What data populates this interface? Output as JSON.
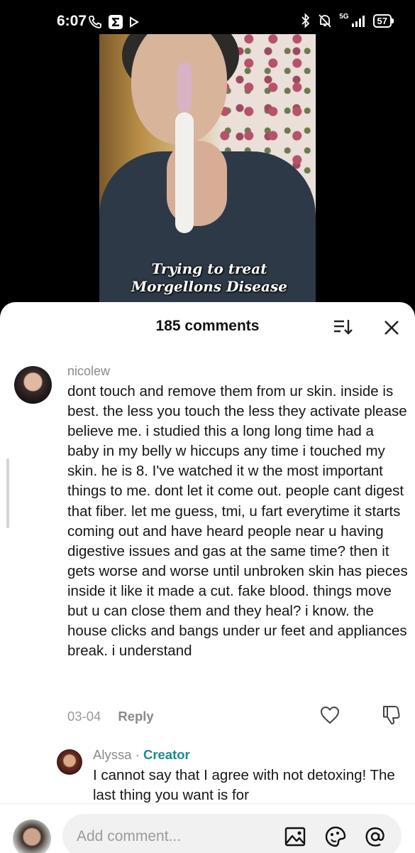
{
  "status_bar": {
    "time": "6:07",
    "network": "5G",
    "battery": "57"
  },
  "video": {
    "caption_line1": "Trying to treat",
    "caption_line2": "Morgellons Disease"
  },
  "comments_header": {
    "count_label": "185 comments"
  },
  "comment": {
    "author": "nicolew",
    "text": "dont touch and remove them from ur skin. inside is best. the less you touch the less they activate please believe me. i studied this a long long time had a baby in my belly w hiccups any time i touched my skin. he is 8. I've watched it w the most important things to me. dont let it come out. people cant digest that fiber. let me guess, tmi, u fart everytime it starts coming out and have heard people near u having digestive issues and gas at the same time? then it gets worse and worse until unbroken skin has pieces inside it like it made a cut. fake blood. things move but u can close them and they heal? i know. the house clicks and bangs under ur feet and appliances break. i understand",
    "date": "03-04",
    "reply_label": "Reply"
  },
  "reply": {
    "author": "Alyssa",
    "separator": "·",
    "badge": "Creator",
    "text": "I cannot say that I agree with not detoxing! The last thing you want is for"
  },
  "input": {
    "placeholder": "Add comment..."
  },
  "icons": {
    "sort": "sort-icon",
    "close": "close-icon",
    "like": "heart-outline-icon",
    "dislike": "thumbs-down-icon",
    "image": "image-icon",
    "emoji": "emoji-icon",
    "mention": "at-icon"
  }
}
